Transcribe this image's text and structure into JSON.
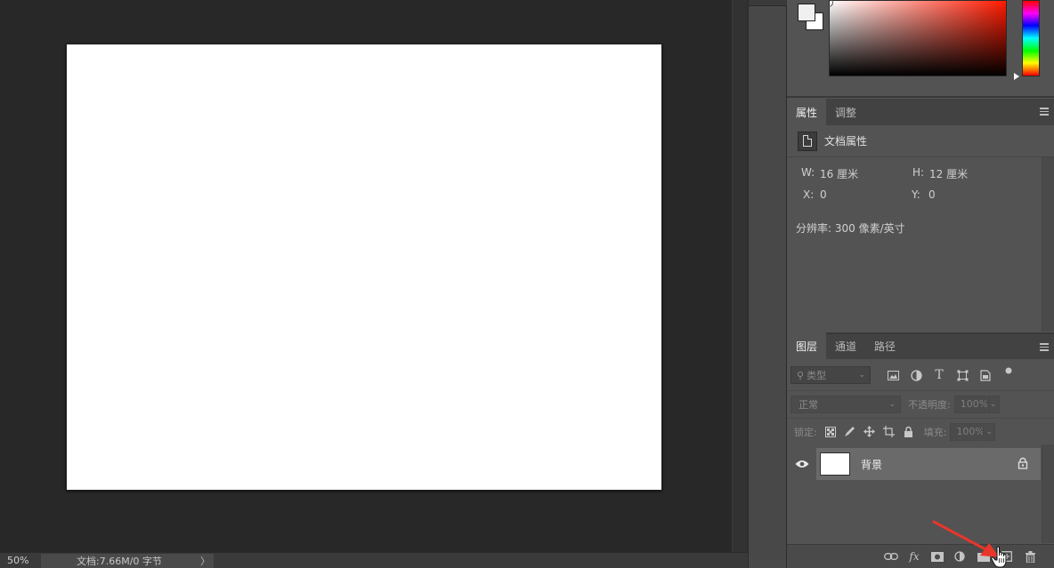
{
  "status_bar": {
    "zoom": "50%",
    "doc_info": "文档:7.66M/0 字节",
    "arrow": "〉"
  },
  "properties_panel": {
    "tabs": [
      {
        "label": "属性",
        "active": true
      },
      {
        "label": "调整",
        "active": false
      }
    ],
    "header_title": "文档属性",
    "width_label": "W:",
    "width_value": "16 厘米",
    "height_label": "H:",
    "height_value": "12 厘米",
    "x_label": "X:",
    "x_value": "0",
    "y_label": "Y:",
    "y_value": "0",
    "resolution": "分辨率: 300 像素/英寸"
  },
  "layers_panel": {
    "tabs": [
      {
        "label": "图层",
        "active": true
      },
      {
        "label": "通道",
        "active": false
      },
      {
        "label": "路径",
        "active": false
      }
    ],
    "filter_placeholder": "类型",
    "blend_mode": "正常",
    "opacity_label": "不透明度:",
    "opacity_value": "100%",
    "lock_label": "锁定:",
    "fill_label": "填充:",
    "fill_value": "100%",
    "layers": [
      {
        "name": "背景",
        "visible": true,
        "locked": true
      }
    ]
  },
  "colors": {
    "foreground": "#f0f0f0",
    "background": "#ffffff",
    "hue_accent": "#ff1a00",
    "annotation_arrow": "#e8362b"
  }
}
